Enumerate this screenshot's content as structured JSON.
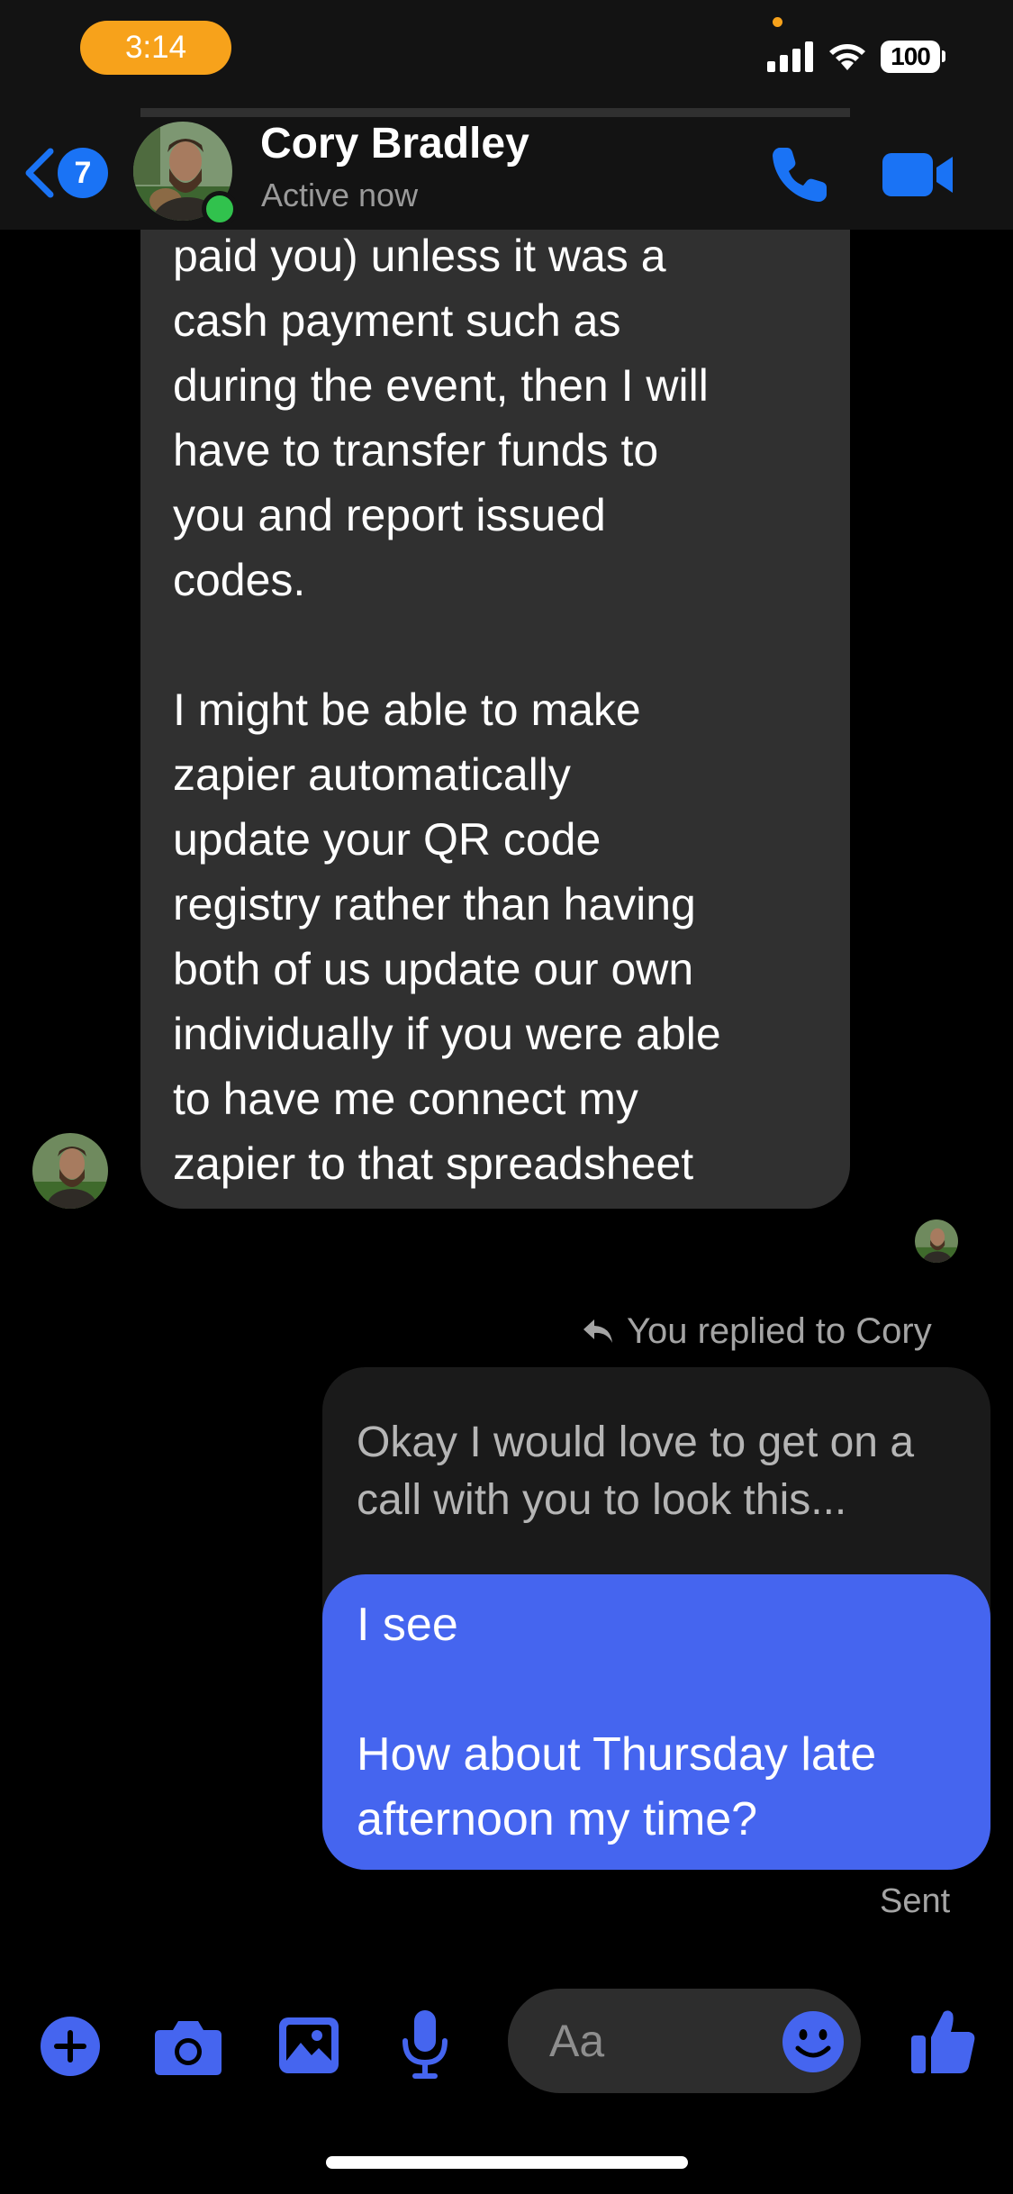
{
  "status_bar": {
    "time": "3:14",
    "battery": "100"
  },
  "header": {
    "back_badge": "7",
    "contact_name": "Cory Bradley",
    "active_status": "Active now"
  },
  "messages": {
    "incoming_text": "paid you) unless it was a\ncash payment such as\nduring the event, then I will\nhave to transfer funds to\nyou and report  issued\ncodes.\n\nI might be able to make\nzapier automatically\nupdate your QR code\nregistry rather than having\nboth of us update our own\nindividually if you were able\nto have me connect my\nzapier to that spreadsheet",
    "reply_label": "You replied to Cory",
    "quoted_text": "Okay I would love to get on a call with you to look this...",
    "outgoing_text": "I see\n\nHow about Thursday late\nafternoon my time?",
    "sent_status": "Sent"
  },
  "composer": {
    "placeholder": "Aa"
  },
  "colors": {
    "accent": "#1a73f5",
    "outgoing_bubble": "#4565ef",
    "incoming_bubble": "#303030",
    "time_pill": "#f7a21b"
  },
  "icons": [
    "back-chevron-icon",
    "phone-icon",
    "video-camera-icon",
    "reply-arrow-icon",
    "plus-icon",
    "camera-icon",
    "image-icon",
    "microphone-icon",
    "emoji-icon",
    "thumbs-up-icon"
  ]
}
